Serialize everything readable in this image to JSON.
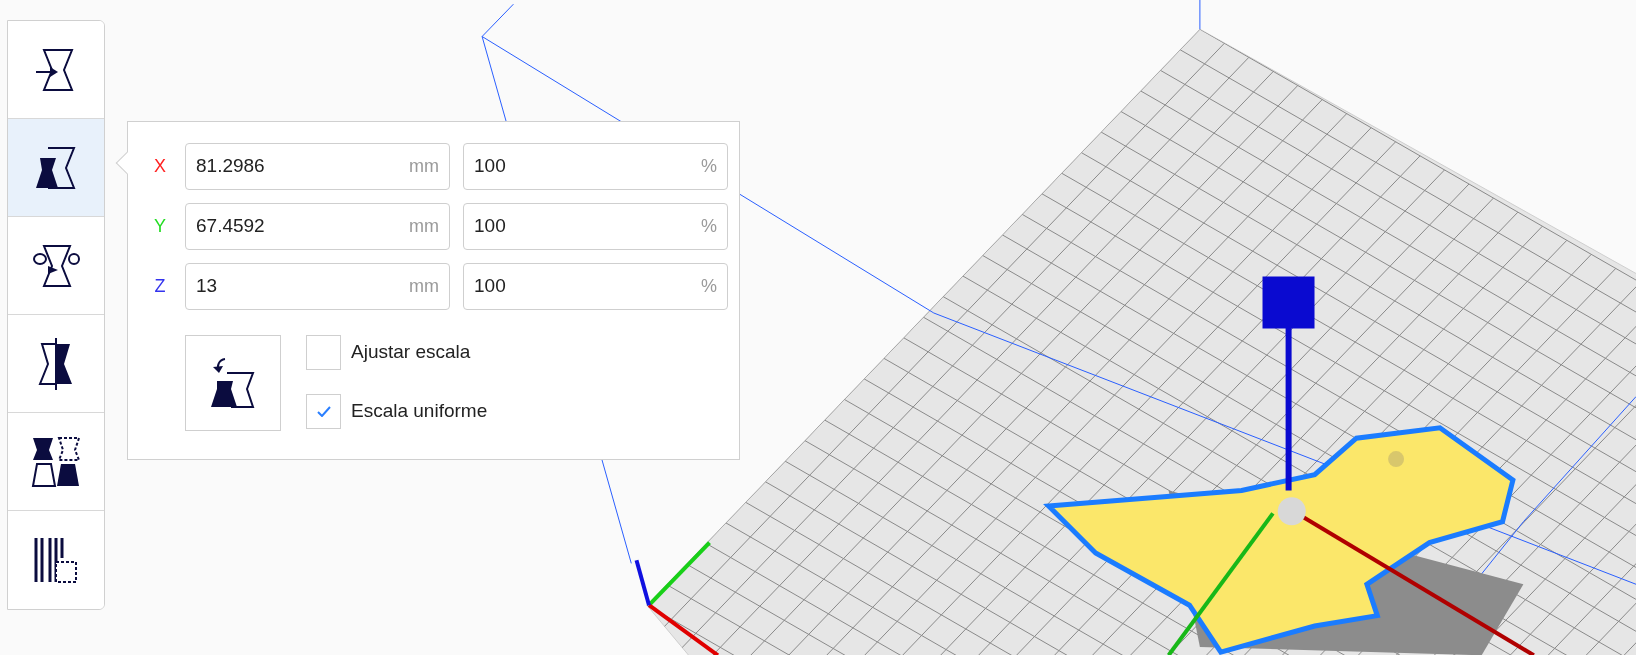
{
  "toolbar": {
    "tools": [
      {
        "kind": "move",
        "selected": false
      },
      {
        "kind": "scale",
        "selected": true
      },
      {
        "kind": "rotate",
        "selected": false
      },
      {
        "kind": "mirror",
        "selected": false
      },
      {
        "kind": "per-model",
        "selected": false
      },
      {
        "kind": "support-blocker",
        "selected": false
      }
    ]
  },
  "scale_panel": {
    "rows": [
      {
        "axis": "X",
        "color": "#ff2222",
        "size": "81.2986",
        "size_unit": "mm",
        "percent": "100",
        "percent_unit": "%"
      },
      {
        "axis": "Y",
        "color": "#22dd22",
        "size": "67.4592",
        "size_unit": "mm",
        "percent": "100",
        "percent_unit": "%"
      },
      {
        "axis": "Z",
        "color": "#3333ee",
        "size": "13",
        "size_unit": "mm",
        "percent": "100",
        "percent_unit": "%"
      }
    ],
    "options": [
      {
        "label": "Ajustar escala",
        "checked": false
      },
      {
        "label": "Escala uniforme",
        "checked": true
      }
    ]
  }
}
